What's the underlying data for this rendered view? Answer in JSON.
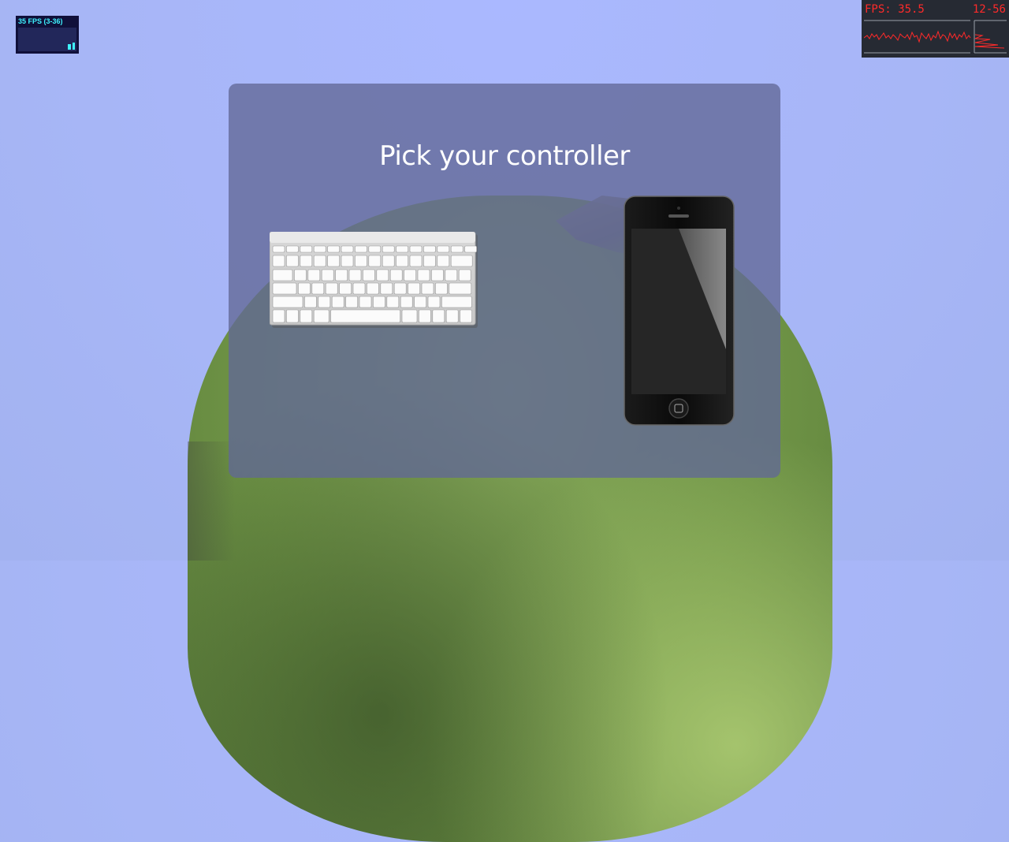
{
  "stats_small": {
    "label": "35 FPS (3-36)"
  },
  "stats_big": {
    "fps_label": "FPS: 35.5",
    "range_label": "12-56"
  },
  "dialog": {
    "title": "Pick your controller",
    "options": [
      {
        "name": "keyboard"
      },
      {
        "name": "phone"
      }
    ]
  },
  "colors": {
    "sky": "#a7b6f6",
    "dialog": "#62689a",
    "stats_small_text": "#3ff3ff",
    "stats_big_text": "#ff2a2a"
  }
}
